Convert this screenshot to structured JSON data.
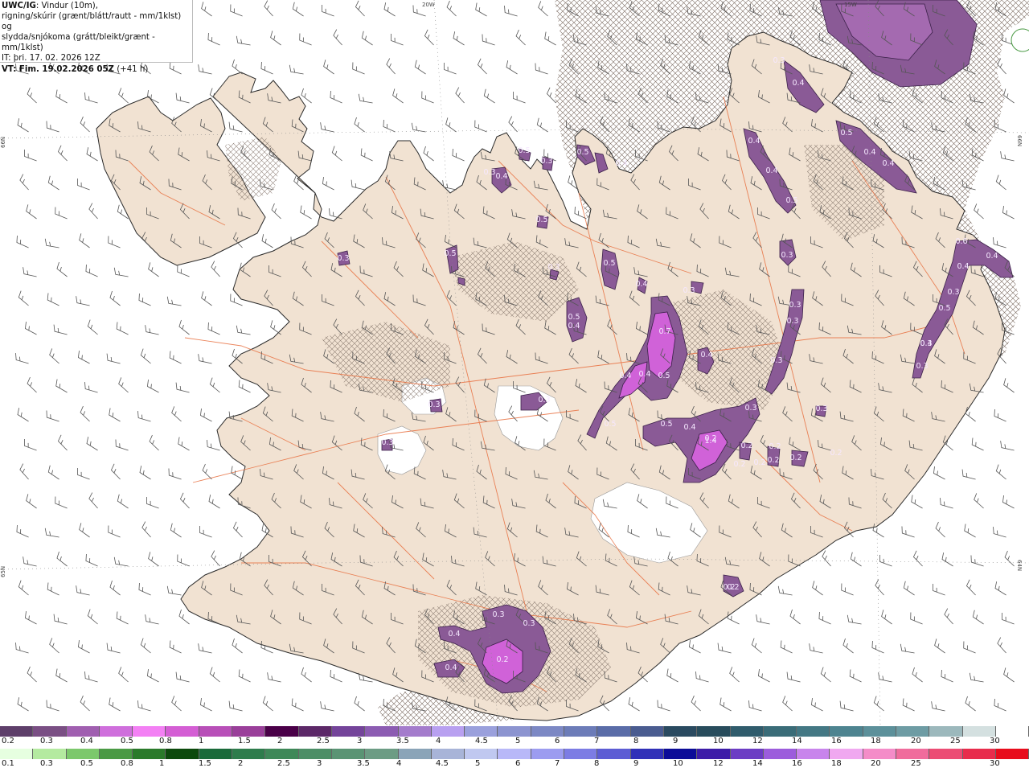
{
  "info_box": {
    "model": "UWC/IG",
    "line1_rest": ": Vindur (10m),",
    "line2": "rigning/skúrir (grænt/blátt/rautt - mm/1klst) og",
    "line3": "slydda/snjókoma (grátt/bleikt/grænt - mm/1klst)",
    "analysis_time": "IT: þri. 17. 02. 2026 12Z",
    "valid_prefix": "VT: Fim. 19.02.2026 05Z",
    "lead_time": " (+41 h)"
  },
  "coordinate_labels": [
    "20W",
    "15W",
    "66N",
    "65N",
    "66N",
    "64N"
  ],
  "snow_scale": {
    "colors": [
      "#5e3f6a",
      "#7a4f84",
      "#a05fb0",
      "#cf6fdc",
      "#f380f4",
      "#d45ed4",
      "#b84fb8",
      "#9a3f9a",
      "#4a0048",
      "#5c2868",
      "#74449a",
      "#8c5cb2",
      "#a47ccc",
      "#b8a0f0",
      "#9aa0dc",
      "#8c94d0",
      "#7c88c4",
      "#6c7cb8",
      "#5a6ca8",
      "#4a5c90",
      "#2a4a60",
      "#284c5c",
      "#305c6c",
      "#3a6c78",
      "#447884",
      "#4e8490",
      "#5c909a",
      "#6e9ca4",
      "#9cb8bc",
      "#d4e0e0",
      "#ffffff"
    ],
    "labels": [
      "0.2",
      "0.3",
      "0.4",
      "0.5",
      "0.8",
      "1",
      "1.5",
      "2",
      "2.5",
      "3",
      "3.5",
      "4",
      "4.5",
      "5",
      "6",
      "7",
      "8",
      "9",
      "10",
      "12",
      "14",
      "16",
      "18",
      "20",
      "25",
      "30"
    ]
  },
  "rain_scale": {
    "colors": [
      "#e6ffe0",
      "#b4eaa0",
      "#7cc86c",
      "#4a9a44",
      "#2a7a2a",
      "#0c4a0c",
      "#1a6a3a",
      "#2e7c4c",
      "#3e8858",
      "#4c8e66",
      "#5a9474",
      "#6c9c84",
      "#8aa4b8",
      "#a8b4d8",
      "#c0c8f0",
      "#b8b8f8",
      "#9c9cf0",
      "#7c7ce4",
      "#5c5cd4",
      "#3030b8",
      "#0c0c98",
      "#3c1ca8",
      "#6c3cc4",
      "#9c5cdc",
      "#c884ec",
      "#f0a8f0",
      "#f48cc8",
      "#f06c9c",
      "#ec4c74",
      "#e82c4c",
      "#e80c1c"
    ],
    "labels": [
      "0.1",
      "0.3",
      "0.5",
      "0.8",
      "1",
      "1.5",
      "2",
      "2.5",
      "3",
      "3.5",
      "4",
      "4.5",
      "5",
      "6",
      "7",
      "8",
      "9",
      "10",
      "12",
      "14",
      "16",
      "18",
      "20",
      "25",
      "30"
    ]
  },
  "contour_labels": [
    "0.4",
    "0.3",
    "0.4",
    "0.5",
    "0.4",
    "0.4",
    "0.5",
    "0.5",
    "0.4",
    "0.3",
    "0.4",
    "0.5",
    "0.3",
    "0.3",
    "0.5",
    "0.3",
    "0.7",
    "0.4",
    "0.5",
    "0.4",
    "0.5",
    "0.4",
    "0.5",
    "0.3",
    "0.4",
    "0.5",
    "0.4",
    "0.3",
    "0.3",
    "0.3",
    "0.3",
    "0.3",
    "0.3",
    "1.4",
    "0.2",
    "0.2",
    "0.2",
    "0.2",
    "0.2",
    "0.3",
    "0.3",
    "0.3",
    "0.4",
    "0.4",
    "0.6",
    "0.5",
    "0.4",
    "0.3",
    "0.3",
    "0.3",
    "0.5",
    "0.5",
    "0.4",
    "0.2",
    "0.2",
    "0.2",
    "0.4",
    "0.3",
    "0.4",
    "0.3",
    "0.4",
    "0.2",
    "0.2",
    "0.2"
  ]
}
